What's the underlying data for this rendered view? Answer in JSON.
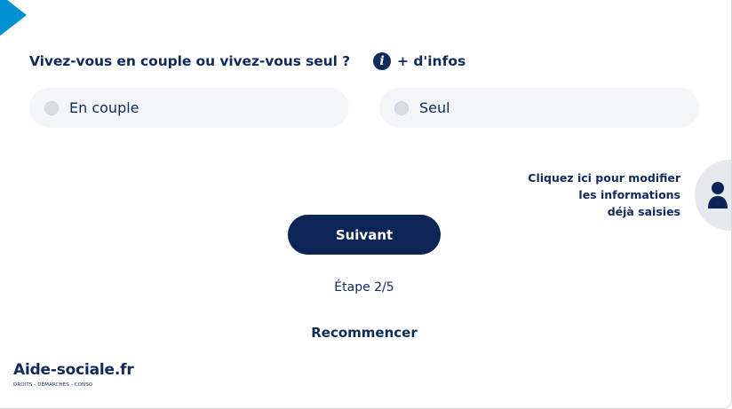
{
  "question": {
    "text": "Vivez-vous en couple ou vivez-vous seul ?",
    "info_label": "+ d'infos",
    "info_icon": "info-icon"
  },
  "options": [
    {
      "label": "En couple",
      "selected": false
    },
    {
      "label": "Seul",
      "selected": false
    }
  ],
  "modify_panel": {
    "lines": [
      "Cliquez ici pour modifier",
      "les informations",
      "déjà saisies"
    ],
    "icon": "user-icon"
  },
  "next_button": {
    "label": "Suivant"
  },
  "step": {
    "text": "Étape 2/5"
  },
  "restart": {
    "label": "Recommencer"
  },
  "logo": {
    "name": "Aide-sociale.fr",
    "tagline": "DROITS - DÉMARCHES - CONSO"
  },
  "colors": {
    "primary": "#0d2456",
    "accent": "#0090d4",
    "option_bg": "#f3f5f9"
  }
}
